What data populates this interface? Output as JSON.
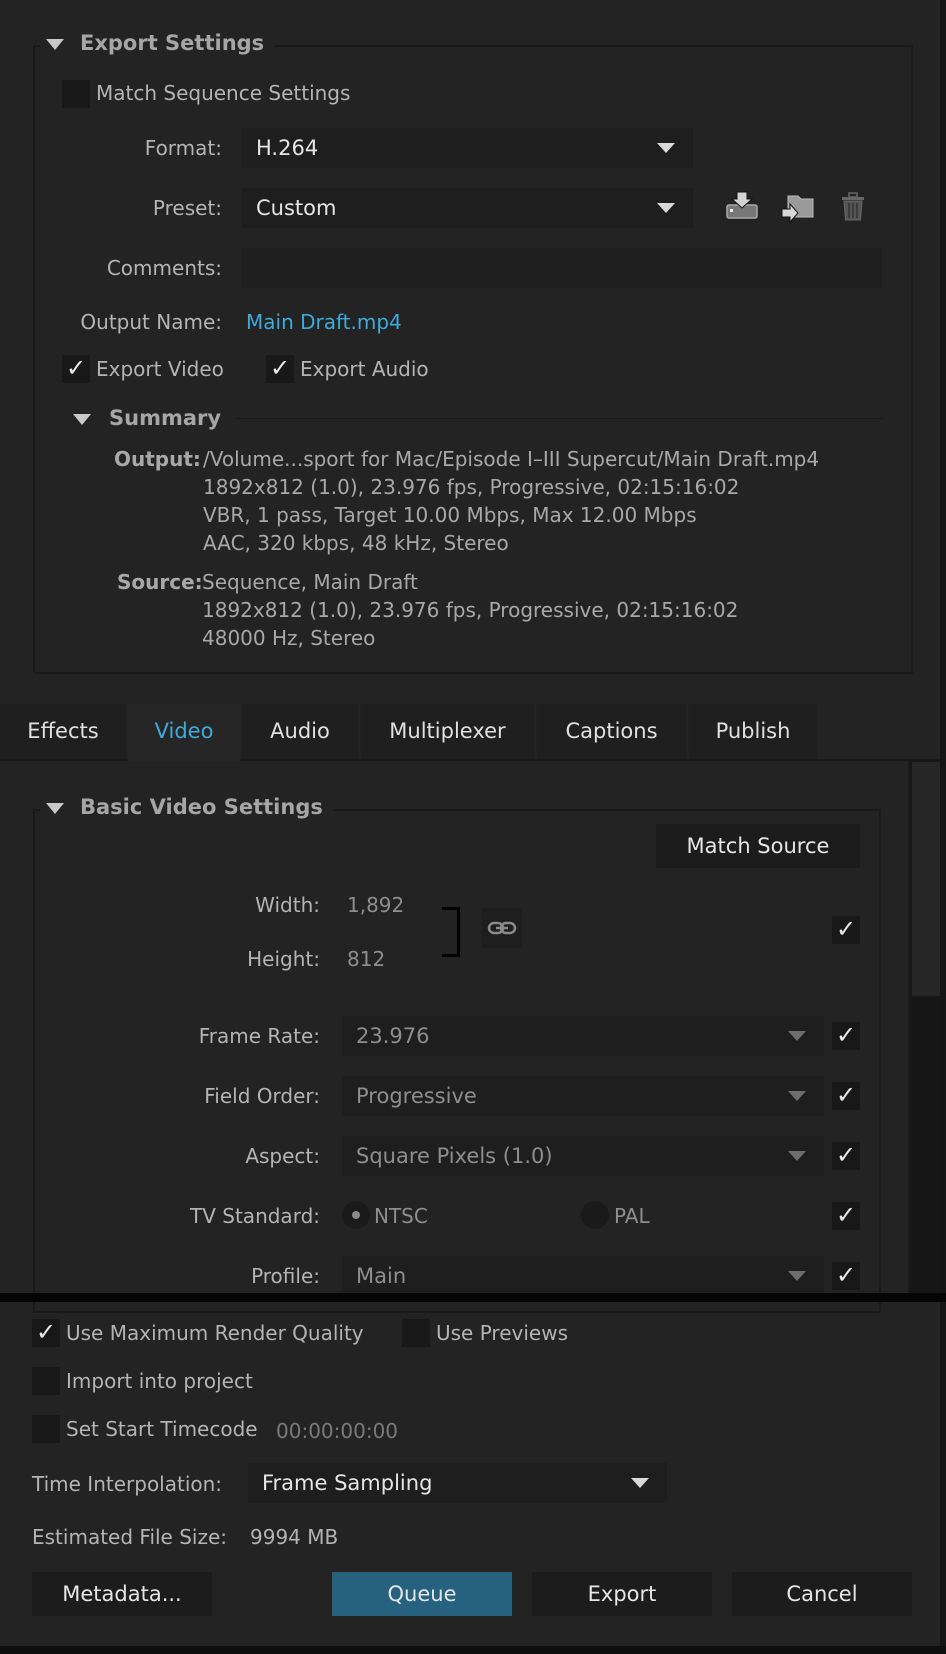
{
  "export_settings": {
    "title": "Export Settings",
    "match_sequence": {
      "label": "Match Sequence Settings",
      "checked": false
    },
    "format": {
      "label": "Format:",
      "value": "H.264"
    },
    "preset": {
      "label": "Preset:",
      "value": "Custom"
    },
    "preset_icons": [
      "save-preset-icon",
      "import-preset-icon",
      "delete-preset-icon"
    ],
    "comments": {
      "label": "Comments:",
      "value": ""
    },
    "output_name": {
      "label": "Output Name:",
      "value": "Main Draft.mp4"
    },
    "export_video": {
      "label": "Export Video",
      "checked": true
    },
    "export_audio": {
      "label": "Export Audio",
      "checked": true
    },
    "summary": {
      "title": "Summary",
      "output_label": "Output:",
      "output_lines": [
        "/Volume...sport for Mac/Episode I–III Supercut/Main Draft.mp4",
        "1892x812 (1.0), 23.976 fps, Progressive, 02:15:16:02",
        "VBR, 1 pass, Target 10.00 Mbps, Max 12.00 Mbps",
        "AAC, 320 kbps, 48 kHz, Stereo"
      ],
      "source_label": "Source:",
      "source_lines": [
        "Sequence, Main Draft",
        "1892x812 (1.0), 23.976 fps, Progressive, 02:15:16:02",
        "48000 Hz, Stereo"
      ]
    }
  },
  "tabs": [
    {
      "label": "Effects",
      "active": false
    },
    {
      "label": "Video",
      "active": true
    },
    {
      "label": "Audio",
      "active": false
    },
    {
      "label": "Multiplexer",
      "active": false
    },
    {
      "label": "Captions",
      "active": false
    },
    {
      "label": "Publish",
      "active": false
    }
  ],
  "video": {
    "section_title": "Basic Video Settings",
    "match_source_label": "Match Source",
    "width": {
      "label": "Width:",
      "value": "1,892"
    },
    "height": {
      "label": "Height:",
      "value": "812"
    },
    "size_checked": true,
    "frame_rate": {
      "label": "Frame Rate:",
      "value": "23.976",
      "checked": true
    },
    "field_order": {
      "label": "Field Order:",
      "value": "Progressive",
      "checked": true
    },
    "aspect": {
      "label": "Aspect:",
      "value": "Square Pixels (1.0)",
      "checked": true
    },
    "tv_standard": {
      "label": "TV Standard:",
      "options": [
        "NTSC",
        "PAL"
      ],
      "selected": "NTSC",
      "checked": true
    },
    "profile": {
      "label": "Profile:",
      "value": "Main",
      "checked": true
    }
  },
  "bottom": {
    "max_render": {
      "label": "Use Maximum Render Quality",
      "checked": true
    },
    "use_previews": {
      "label": "Use Previews",
      "checked": false
    },
    "import_project": {
      "label": "Import into project",
      "checked": false
    },
    "start_timecode": {
      "label": "Set Start Timecode",
      "checked": false,
      "value": "00:00:00:00"
    },
    "time_interpolation": {
      "label": "Time Interpolation:",
      "value": "Frame Sampling"
    },
    "file_size": {
      "label": "Estimated File Size:",
      "value": "9994 MB"
    },
    "buttons": {
      "metadata": "Metadata...",
      "queue": "Queue",
      "export": "Export",
      "cancel": "Cancel"
    }
  },
  "colors": {
    "accent": "#3fa9dc",
    "primary_button": "#26617f",
    "background": "#232323"
  }
}
